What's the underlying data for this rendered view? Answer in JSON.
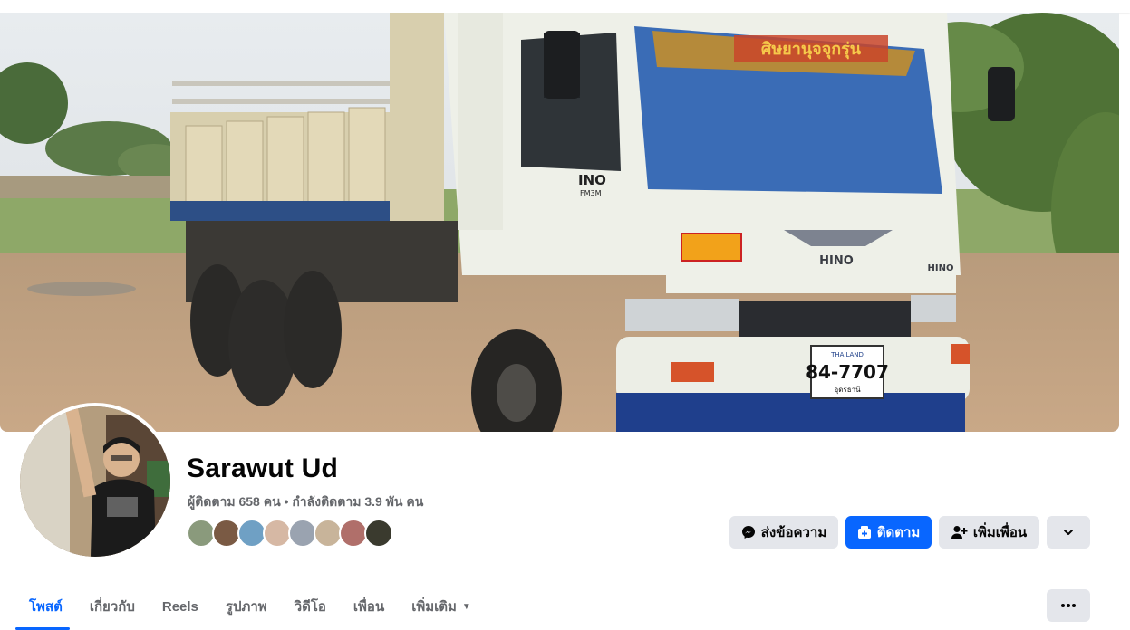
{
  "profile": {
    "name": "Sarawut Ud",
    "stats": "ผู้ติดตาม 658 คน • กำลังติดตาม 3.9 พัน คน"
  },
  "cover": {
    "plate_text": "84-7707",
    "plate_country": "THAILAND",
    "plate_province": "อุดรธานี",
    "brand_grille": "HINO",
    "brand_door": "HINO",
    "door_model": "INO",
    "door_badge": "FM3M",
    "windshield_sticker": "ศิษยานุจจุกรุ่น"
  },
  "actions": {
    "message_label": "ส่งข้อความ",
    "follow_label": "ติดตาม",
    "add_friend_label": "เพิ่มเพื่อน"
  },
  "tabs": [
    {
      "label": "โพสต์",
      "active": true
    },
    {
      "label": "เกี่ยวกับ"
    },
    {
      "label": "Reels"
    },
    {
      "label": "รูปภาพ"
    },
    {
      "label": "วิดีโอ"
    },
    {
      "label": "เพื่อน"
    },
    {
      "label": "เพิ่มเติม"
    }
  ],
  "friend_avatars": [
    "friend-1",
    "friend-2",
    "friend-3",
    "friend-4",
    "friend-5",
    "friend-6",
    "friend-7",
    "friend-8"
  ],
  "icons": {
    "messenger": "messenger-icon",
    "follow": "follow-icon",
    "add_friend": "add-friend-icon",
    "chevron": "chevron-down-icon",
    "more": "more-dots-icon"
  },
  "colors": {
    "accent": "#0866ff",
    "button_grey": "#e4e6eb",
    "secondary_text": "#65676b",
    "divider": "#ced0d4"
  }
}
